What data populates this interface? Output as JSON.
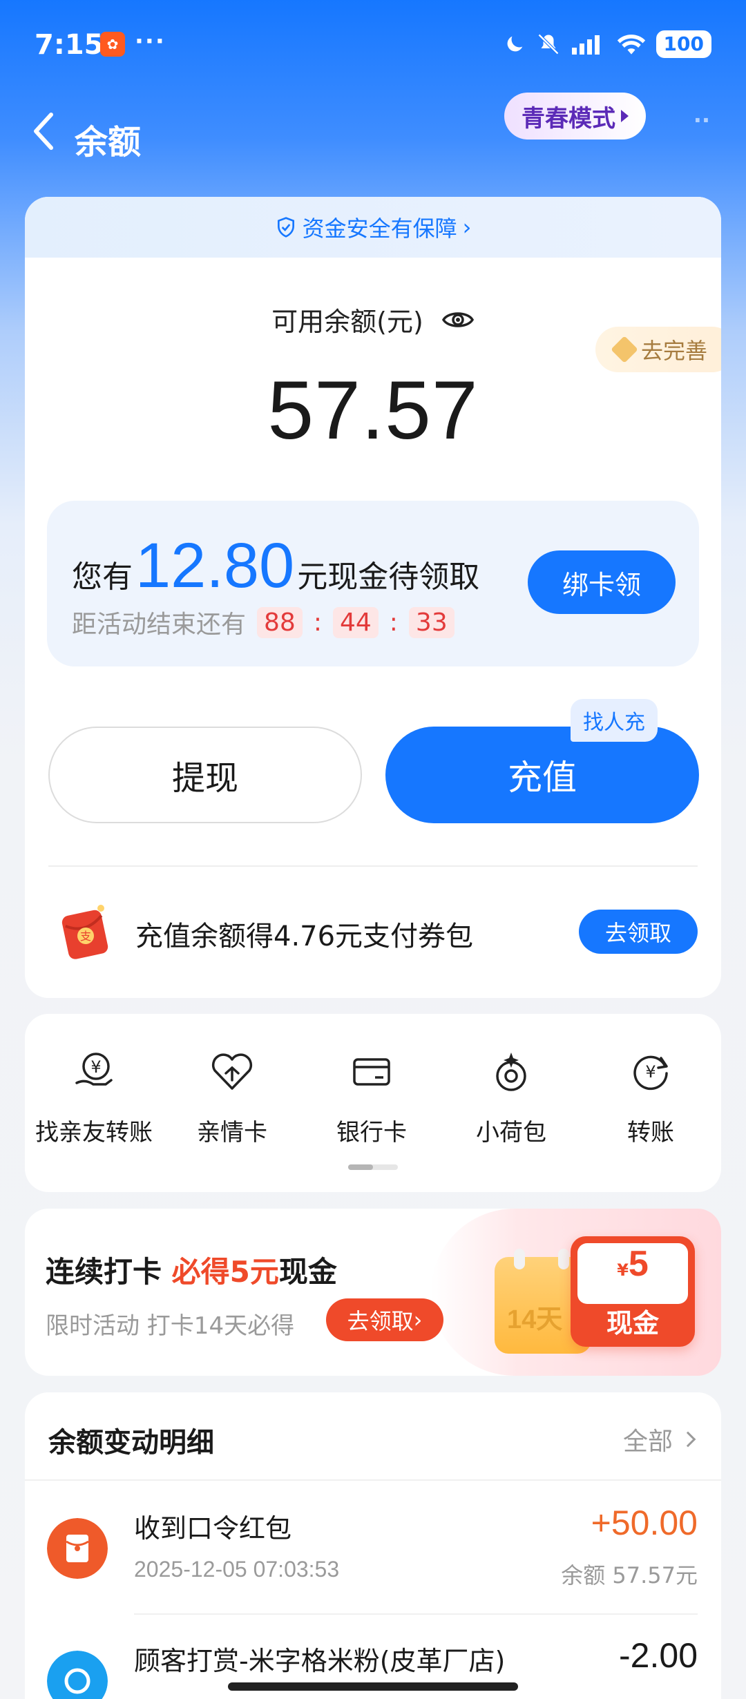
{
  "status_bar": {
    "time": "7:15",
    "more": "···",
    "battery": "100"
  },
  "header": {
    "title": "余额",
    "youth_mode": "青春模式"
  },
  "balance_card": {
    "safety_link": "资金安全有保障",
    "available_label": "可用余额(元)",
    "balance": "57.57",
    "improve_badge": "去完善",
    "cash_offer": {
      "prefix": "您有",
      "amount": "12.80",
      "suffix": "元现金待领取",
      "countdown_label": "距活动结束还有",
      "hours": "88",
      "minutes": "44",
      "seconds": "33",
      "separator": ":",
      "button": "绑卡领"
    },
    "withdraw_button": "提现",
    "recharge_button": "充值",
    "find_tag": "找人充",
    "promo_text": "充值余额得4.76元支付券包",
    "promo_button": "去领取"
  },
  "quick_actions": [
    {
      "label": "找亲友转账",
      "icon": "hand-yen-icon"
    },
    {
      "label": "亲情卡",
      "icon": "heart-card-icon"
    },
    {
      "label": "银行卡",
      "icon": "bank-card-icon"
    },
    {
      "label": "小荷包",
      "icon": "pouch-icon"
    },
    {
      "label": "转账",
      "icon": "yen-transfer-icon"
    }
  ],
  "checkin": {
    "title_prefix": "连续打卡 ",
    "title_highlight": "必得5元",
    "title_suffix": "现金",
    "subtitle": "限时活动 打卡14天必得",
    "button": "去领取",
    "calendar_text": "14天",
    "reward_currency": "¥",
    "reward_amount": "5",
    "reward_label": "现金"
  },
  "transactions": {
    "title": "余额变动明细",
    "all_link": "全部",
    "items": [
      {
        "name": "收到口令红包",
        "time": "2025-12-05 07:03:53",
        "amount": "+50.00",
        "balance": "余额 57.57元"
      },
      {
        "name": "顾客打赏-米字格米粉(皮革厂店)",
        "time": "",
        "amount": "-2.00",
        "balance": ""
      }
    ]
  },
  "colors": {
    "primary": "#1677ff",
    "accent_red": "#ef4a2a",
    "income": "#ef6a2a"
  }
}
